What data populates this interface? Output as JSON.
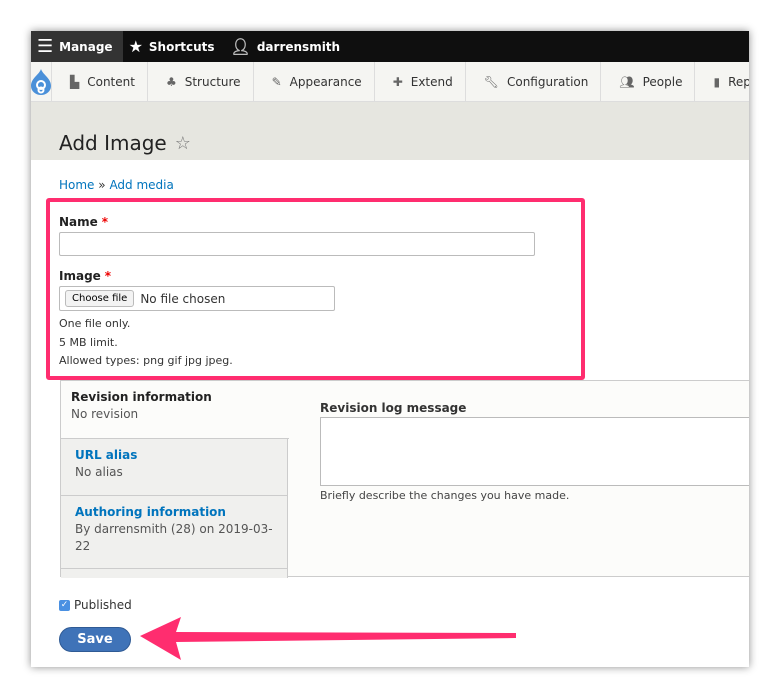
{
  "toolbar": {
    "manage": "Manage",
    "shortcuts": "Shortcuts",
    "user": "darrensmith"
  },
  "tray": [
    {
      "label": "Content",
      "icon": "file-icon"
    },
    {
      "label": "Structure",
      "icon": "sitemap-icon"
    },
    {
      "label": "Appearance",
      "icon": "brush-icon"
    },
    {
      "label": "Extend",
      "icon": "puzzle-icon"
    },
    {
      "label": "Configuration",
      "icon": "wrench-icon"
    },
    {
      "label": "People",
      "icon": "people-icon"
    },
    {
      "label": "Reports",
      "icon": "bar-chart-icon"
    }
  ],
  "page": {
    "title": "Add Image",
    "breadcrumb_home": "Home",
    "breadcrumb_sep": "»",
    "breadcrumb_current": "Add media"
  },
  "form": {
    "name_label": "Name",
    "name_value": "",
    "required": "*",
    "image_label": "Image",
    "choose_file": "Choose file",
    "no_file": "No file chosen",
    "help1": "One file only.",
    "help2": "5 MB limit.",
    "help3": "Allowed types: png gif jpg jpeg."
  },
  "tabs": [
    {
      "title": "Revision information",
      "summary": "No revision"
    },
    {
      "title": "URL alias",
      "summary": "No alias"
    },
    {
      "title": "Authoring information",
      "summary": "By darrensmith (28) on 2019-03-22"
    }
  ],
  "revision": {
    "label": "Revision log message",
    "value": "",
    "description": "Briefly describe the changes you have made."
  },
  "published": {
    "label": "Published",
    "checked": true
  },
  "save_label": "Save",
  "colors": {
    "highlight": "#ff2d6f",
    "accent": "#3f73b8",
    "link": "#0074bd"
  }
}
